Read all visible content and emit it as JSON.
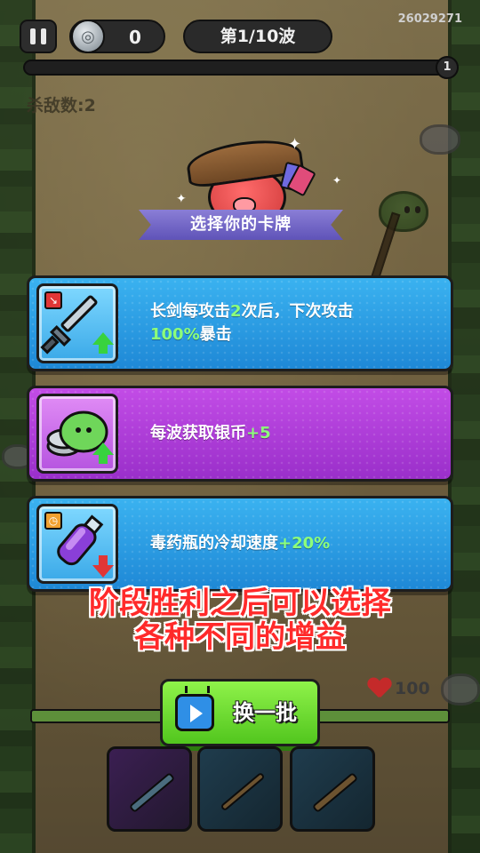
{
  "hud": {
    "build_id": "26029271",
    "coins": "0",
    "wave": "第1/10波",
    "wave_end_marker": "1",
    "kill_count": "杀敌数:2",
    "progress": 0.0
  },
  "banner": {
    "title": "选择你的卡牌"
  },
  "cards": [
    {
      "icon": "sword-upgrade-icon",
      "color": "blue",
      "text_parts": [
        "长剑每攻击",
        "2",
        "次后，下次攻击",
        "100%",
        "暴击"
      ]
    },
    {
      "icon": "silver-coin-slime-icon",
      "color": "purple",
      "text_parts": [
        "每波获取银币",
        "+5"
      ]
    },
    {
      "icon": "poison-potion-icon",
      "color": "blue",
      "text_parts": [
        "毒药瓶的冷却速度",
        "+20%"
      ]
    }
  ],
  "caption": {
    "line1": "阶段胜利之后可以选择",
    "line2": "各种不同的增益"
  },
  "player": {
    "hp": "100",
    "hp_fraction": 1.0
  },
  "refresh_button": {
    "label": "换一批",
    "icon": "video-ad-icon"
  },
  "weapon_slots": [
    {
      "icon": "crossbow-icon"
    },
    {
      "icon": "bow-icon"
    },
    {
      "icon": "sword-icon"
    }
  ],
  "colors": {
    "card_blue": "#1e88d6",
    "card_purple": "#9a2fca",
    "highlight_green": "#8dff7a",
    "caption_red": "#ff2a2a",
    "refresh_green": "#52c61e"
  }
}
